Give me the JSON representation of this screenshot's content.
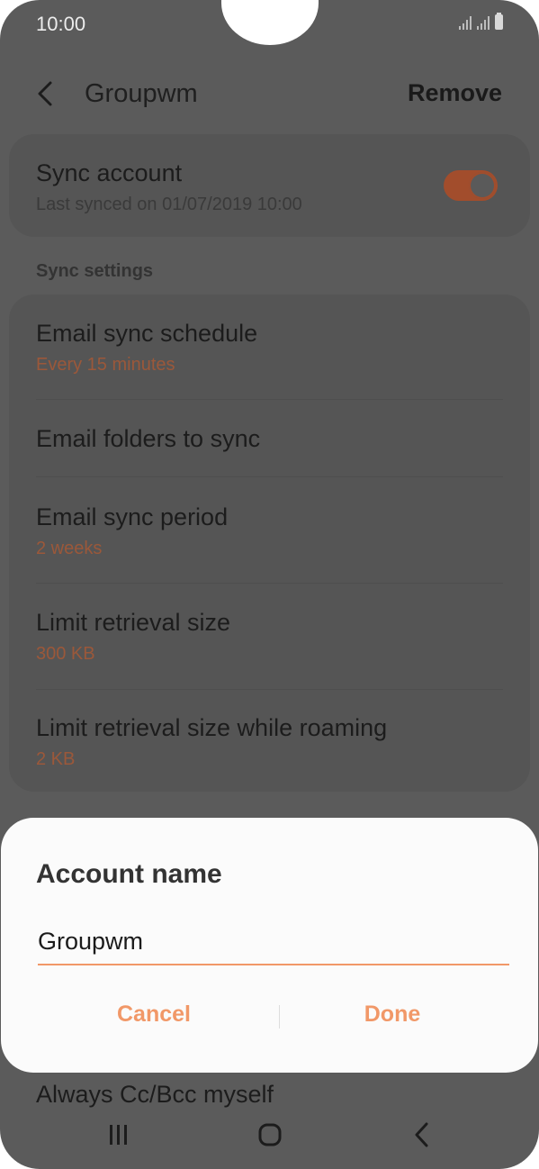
{
  "status": {
    "time": "10:00"
  },
  "header": {
    "title": "Groupwm",
    "remove_label": "Remove"
  },
  "sync_account": {
    "title": "Sync account",
    "subtitle": "Last synced on 01/07/2019  10:00",
    "enabled": true
  },
  "section": {
    "label": "Sync settings"
  },
  "settings": [
    {
      "title": "Email sync schedule",
      "value": "Every 15 minutes"
    },
    {
      "title": "Email folders to sync",
      "value": ""
    },
    {
      "title": "Email sync period",
      "value": "2 weeks"
    },
    {
      "title": "Limit retrieval size",
      "value": "300 KB"
    },
    {
      "title": "Limit retrieval size while roaming",
      "value": "2 KB"
    }
  ],
  "peek_item": {
    "title": "Always Cc/Bcc myself"
  },
  "dialog": {
    "title": "Account name",
    "input_value": "Groupwm",
    "cancel_label": "Cancel",
    "done_label": "Done"
  },
  "colors": {
    "accent": "#f19868",
    "dim_accent": "#a24d2c",
    "scrim": "#5b5b5b"
  }
}
